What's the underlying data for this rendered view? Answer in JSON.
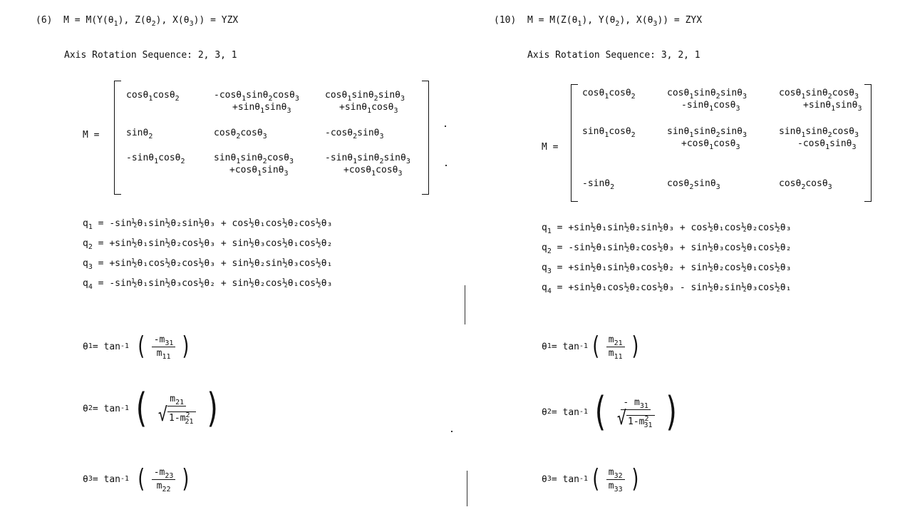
{
  "left": {
    "heading": {
      "label": "(6)",
      "m": "M = M(Y(θ",
      "s1": "1",
      "m2": "), Z(θ",
      "s2": "2",
      "m3": "), X(θ",
      "s3": "3",
      "m4": ")) = YZX"
    },
    "sequence": "Axis Rotation Sequence:  2, 3, 1",
    "matrix_label": "M =",
    "q": [
      {
        "name": "q",
        "sub": "1",
        "expr": " = -sin½θ₁sin½θ₂sin½θ₃ + cos½θ₁cos½θ₂cos½θ₃"
      },
      {
        "name": "q",
        "sub": "2",
        "expr": " = +sin½θ₁sin½θ₂cos½θ₃ + sin½θ₃cos½θ₁cos½θ₂"
      },
      {
        "name": "q",
        "sub": "3",
        "expr": " = +sin½θ₁cos½θ₂cos½θ₃ + sin½θ₂sin½θ₃cos½θ₁"
      },
      {
        "name": "q",
        "sub": "4",
        "expr": " = -sin½θ₁sin½θ₃cos½θ₂ + sin½θ₂cos½θ₁cos½θ₃"
      }
    ],
    "theta1": {
      "lhs": "θ",
      "sub": "1",
      "eq": " = tan",
      "sup": "-1",
      "num": "-m",
      "num_sub": "31",
      "den": "m",
      "den_sub": "11"
    },
    "theta2": {
      "lhs": "θ",
      "sub": "2",
      "eq": " = tan",
      "sup": "-1",
      "num": "m",
      "num_sub": "21",
      "den": "1-m",
      "den_sup": "2",
      "den_sub": "21"
    },
    "theta3": {
      "lhs": "θ",
      "sub": "3",
      "eq": " = tan",
      "sup": "-1",
      "num": "-m",
      "num_sub": "23",
      "den": "m",
      "den_sub": "22"
    }
  },
  "right": {
    "heading": {
      "label": "(10)",
      "m": "M = M(Z(θ",
      "s1": "1",
      "m2": "), Y(θ",
      "s2": "2",
      "m3": "), X(θ",
      "s3": "3",
      "m4": ")) = ZYX"
    },
    "sequence": "Axis Rotation Sequence:  3, 2, 1",
    "matrix_label": "M =",
    "q": [
      {
        "name": "q",
        "sub": "1",
        "expr": " = +sin½θ₁sin½θ₂sin½θ₃ + cos½θ₁cos½θ₂cos½θ₃"
      },
      {
        "name": "q",
        "sub": "2",
        "expr": " = -sin½θ₁sin½θ₂cos½θ₃ + sin½θ₃cos½θ₁cos½θ₂"
      },
      {
        "name": "q",
        "sub": "3",
        "expr": " = +sin½θ₁sin½θ₃cos½θ₂ + sin½θ₂cos½θ₁cos½θ₃"
      },
      {
        "name": "q",
        "sub": "4",
        "expr": " = +sin½θ₁cos½θ₂cos½θ₃ - sin½θ₂sin½θ₃cos½θ₁"
      }
    ],
    "theta1": {
      "lhs": "θ",
      "sub": "1",
      "eq": " = tan",
      "sup": "-1",
      "num": "m",
      "num_sub": "21",
      "den": "m",
      "den_sub": "11"
    },
    "theta2": {
      "lhs": "θ",
      "sub": "2",
      "eq": " = tan",
      "sup": "-1",
      "num": "- m",
      "num_sub": "31",
      "den": "1-m",
      "den_sup": "2",
      "den_sub": "31"
    },
    "theta3": {
      "lhs": "θ",
      "sub": "3",
      "eq": " = tan",
      "sup": "-1",
      "num": "m",
      "num_sub": "32",
      "den": "m",
      "den_sub": "33"
    }
  }
}
